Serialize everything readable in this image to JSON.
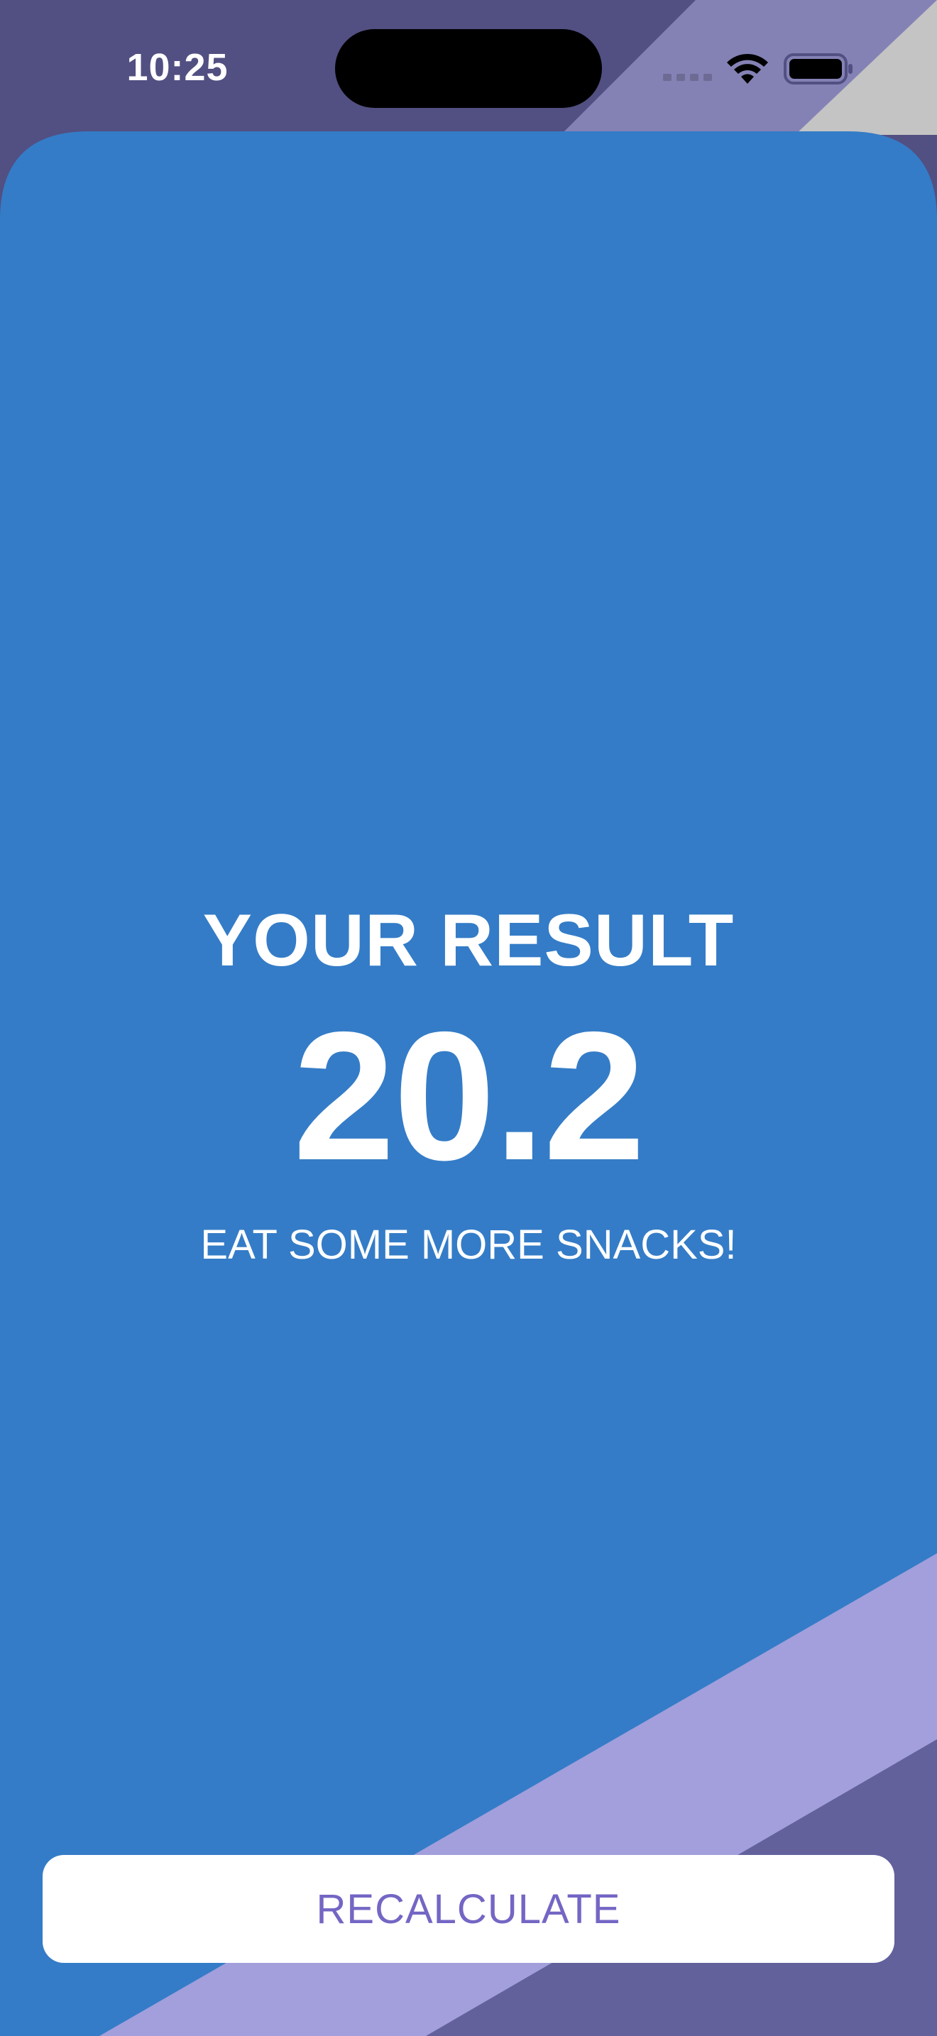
{
  "status_bar": {
    "time": "10:25"
  },
  "result": {
    "title": "YOUR RESULT",
    "value": "20.2",
    "message": "EAT SOME MORE SNACKS!"
  },
  "actions": {
    "recalculate_label": "RECALCULATE"
  },
  "colors": {
    "card": "#347cc7",
    "backdrop_dark": "#524f82",
    "backdrop_mid": "#8482b5",
    "backdrop_light": "#c4c4c4",
    "stripe_light": "#a29fdc",
    "stripe_dark": "#62619c",
    "button_text": "#7366c4"
  }
}
